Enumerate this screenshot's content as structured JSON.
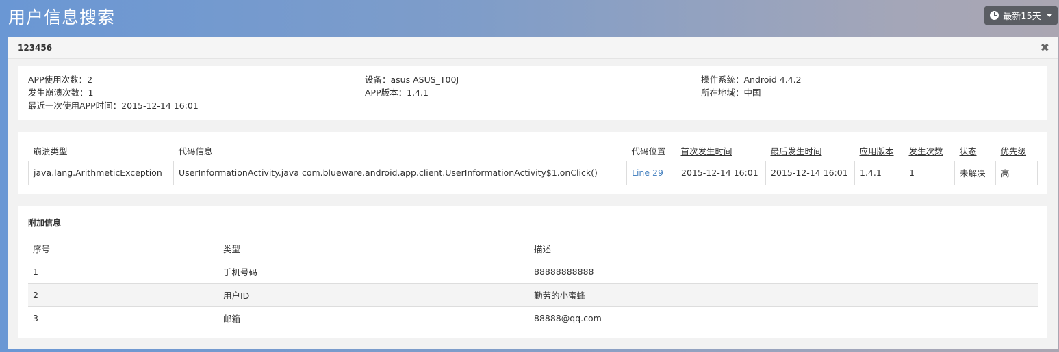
{
  "header": {
    "title": "用户信息搜索",
    "range_label": "最新15天"
  },
  "panel": {
    "title": "123456",
    "close_glyph": "✖"
  },
  "info": {
    "col1": [
      "APP使用次数：2",
      "发生崩溃次数：1",
      "最近一次使用APP时间：2015-12-14 16:01"
    ],
    "col2": [
      "设备：asus ASUS_T00J",
      "APP版本：1.4.1"
    ],
    "col3": [
      "操作系统：Android 4.4.2",
      "所在地域：中国"
    ]
  },
  "crash_table": {
    "headers": [
      "崩溃类型",
      "代码信息",
      "代码位置",
      "首次发生时间",
      "最后发生时间",
      "应用版本",
      "发生次数",
      "状态",
      "优先级"
    ],
    "rows": [
      [
        "java.lang.ArithmeticException",
        "UserInformationActivity.java com.blueware.android.app.client.UserInformationActivity$1.onClick()",
        "Line 29",
        "2015-12-14 16:01",
        "2015-12-14 16:01",
        "1.4.1",
        "1",
        "未解决",
        "高"
      ]
    ]
  },
  "extra": {
    "title": "附加信息",
    "headers": [
      "序号",
      "类型",
      "描述"
    ],
    "rows": [
      [
        "1",
        "手机号码",
        "88888888888"
      ],
      [
        "2",
        "用户ID",
        "勤劳的小蜜蜂"
      ],
      [
        "3",
        "邮箱",
        "88888@qq.com"
      ]
    ]
  },
  "colors": {
    "link": "#4a84c1",
    "button_bg": "#5a5d63"
  },
  "icons": {
    "range_button": "clock-icon",
    "close": "close-icon"
  }
}
